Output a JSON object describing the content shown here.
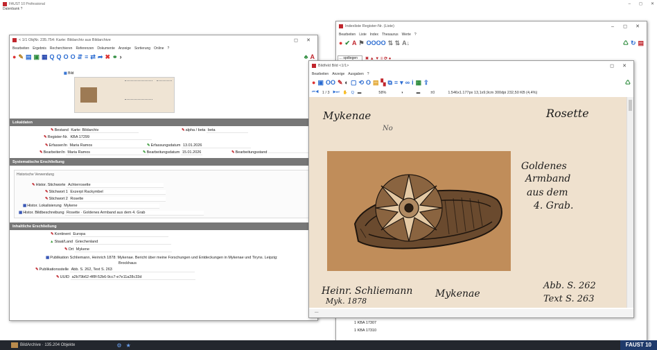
{
  "app": {
    "title": "FAUST 10 Professional",
    "menu": "Datenbank  ?",
    "brand": "FAUST 10",
    "brand_bg": "#1f3a6b"
  },
  "status": {
    "text": "BildArchive · 135.204 Objekte"
  },
  "main": {
    "title": "< 1/1 ObjNr. 235.754: Karte: Bildarchiv aus Bildarchive",
    "menu": [
      "Bearbeiten",
      "Ergebnis",
      "Recherchieren",
      "Referenzen",
      "Dokumente",
      "Anzeige",
      "Sortierung",
      "Online",
      "?"
    ],
    "thumb_label": "Bild",
    "sections": {
      "lok": "Lokaldaten",
      "sys": "Systematische Erschließung",
      "inh": "Inhaltliche Erschließung"
    },
    "fields": {
      "bestand_label": "Bestand",
      "bestand_value": "Karte: Bildarchiv",
      "alpha_label": "alpha / beta",
      "alpha_value": "beta",
      "regnr_label": "Register-Nr.",
      "regnr_value": "KBA 17299",
      "erfasser_label": "Erfasser/in",
      "erfasser_value": "Maria Ramos",
      "erfdat_label": "Erfassungsdatum",
      "erfdat_value": "13.01.2026",
      "bearb_label": "Bearbeiter/in",
      "bearb_value": "Maria Ramos",
      "bearbdat_label": "Bearbeitungsdatum",
      "bearbdat_value": "15.01.2026",
      "bearbstand_label": "Bearbeitungsstand",
      "hist_label": "Historische Verwendung",
      "stichw_label": "Histor. Stichworte",
      "stichw_value": "Achterrosette",
      "sw1_label": "Stichwort 1",
      "sw1_value": "Exzerpt Rackymbel",
      "sw2_label": "Stichwort 2",
      "sw2_value": "Rosette",
      "lokal_label": "Histor. Lokalisierung",
      "lokal_value": "Mykene",
      "bildbes_label": "Histor. Bildbeschreibung",
      "bildbes_value": "Rosette · Goldenes Armband aus dem 4. Grab",
      "kontinent_label": "Kontinent",
      "kontinent_value": "Europa",
      "staat_label": "Staat/Land",
      "staat_value": "Griechenland",
      "ort_label": "Ort",
      "ort_value": "Mykene",
      "pub_label": "Publikation",
      "pub_value": "Schliemann, Heinrich 1878: Mykenae. Bericht über meine Forschungen und Entdeckungen in Mykenae und Tiryns. Leipzig:",
      "pub_value2": "Brockhaus",
      "pubst_label": "Publikationsstelle",
      "pubst_value": "Abb. S. 262, Text S. 263",
      "uuid_label": "UUID",
      "uuid_value": "a2b79b62-4f8f-52b6-9cc7-e7e11a28c33d"
    }
  },
  "register": {
    "title": "Indexliste Register-Nr. (Liste)",
    "menu": [
      "Bearbeiten",
      "Liste",
      "Index",
      "Thesaurus",
      "Werte",
      "?"
    ],
    "search_value": "… spdtegen",
    "entries": [
      "1 KBA 17307",
      "1 KBA 17310"
    ]
  },
  "viewer": {
    "title": "Bildfeld Bild <1/1>",
    "menu": [
      "Bearbeiten",
      "Anzeige",
      "Ausgaben",
      "?"
    ],
    "page": "1 / 3",
    "zoom": "58%",
    "gamma": "±0",
    "info": "1.546x1.177px   13,1x9,9cm   300dpi   232,50 KB (4,4%)",
    "paper_color": "#efe1ce",
    "sketch_bg": "#c08d5a",
    "writing": {
      "top_left": "Mykenae",
      "top_mid": "No",
      "top_right": "Rosette",
      "side_1": "Goldenes",
      "side_2": "Armband",
      "side_3": "aus dem",
      "side_4": "4. Grab.",
      "bottom_1": "Heinr. Schliemann",
      "bottom_1b": "Myk. 1878",
      "bottom_2": "Mykenae",
      "bottom_3": "Abb. S. 262",
      "bottom_3b": "Text S. 263"
    }
  }
}
